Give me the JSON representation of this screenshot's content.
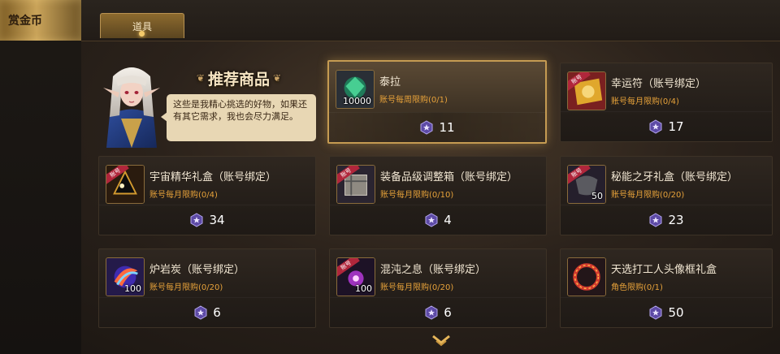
{
  "sidebar": {
    "active_tab": "赏金币"
  },
  "tabs": [
    {
      "label": "道具"
    }
  ],
  "recommend": {
    "title": "推荐商品",
    "speech": "这些是我精心挑选的好物，如果还有其它需求，我也会尽力满足。"
  },
  "currency": {
    "icon": "purple-star-coin-icon",
    "color": "#7b5bc4"
  },
  "items": [
    {
      "name": "泰拉",
      "limit": "账号每周限购(0/1)",
      "price": "11",
      "qty": "10000",
      "bound_tag": "",
      "icon": "green-ore-icon"
    },
    {
      "name": "幸运符（账号绑定）",
      "limit": "账号每月限购(0/4)",
      "price": "17",
      "qty": "",
      "bound_tag": "账号",
      "icon": "gold-talisman-icon"
    },
    {
      "name": "宇宙精华礼盒（账号绑定）",
      "limit": "账号每月限购(0/4)",
      "price": "34",
      "qty": "",
      "bound_tag": "账号",
      "icon": "black-crystal-icon"
    },
    {
      "name": "装备品级调整箱（账号绑定）",
      "limit": "账号每月限购(0/10)",
      "price": "4",
      "qty": "",
      "bound_tag": "账号",
      "icon": "metal-box-icon"
    },
    {
      "name": "秘能之牙礼盒（账号绑定）",
      "limit": "账号每月限购(0/20)",
      "price": "23",
      "qty": "50",
      "bound_tag": "账号",
      "icon": "fang-stone-icon"
    },
    {
      "name": "炉岩炭（账号绑定）",
      "limit": "账号每月限购(0/20)",
      "price": "6",
      "qty": "100",
      "bound_tag": "",
      "icon": "blue-flame-orb-icon"
    },
    {
      "name": "混沌之息（账号绑定）",
      "limit": "账号每月限购(0/20)",
      "price": "6",
      "qty": "100",
      "bound_tag": "账号",
      "icon": "purple-chaos-icon"
    },
    {
      "name": "天选打工人头像框礼盒",
      "limit": "角色限购(0/1)",
      "price": "50",
      "qty": "",
      "bound_tag": "",
      "icon": "red-ring-frame-icon"
    }
  ]
}
